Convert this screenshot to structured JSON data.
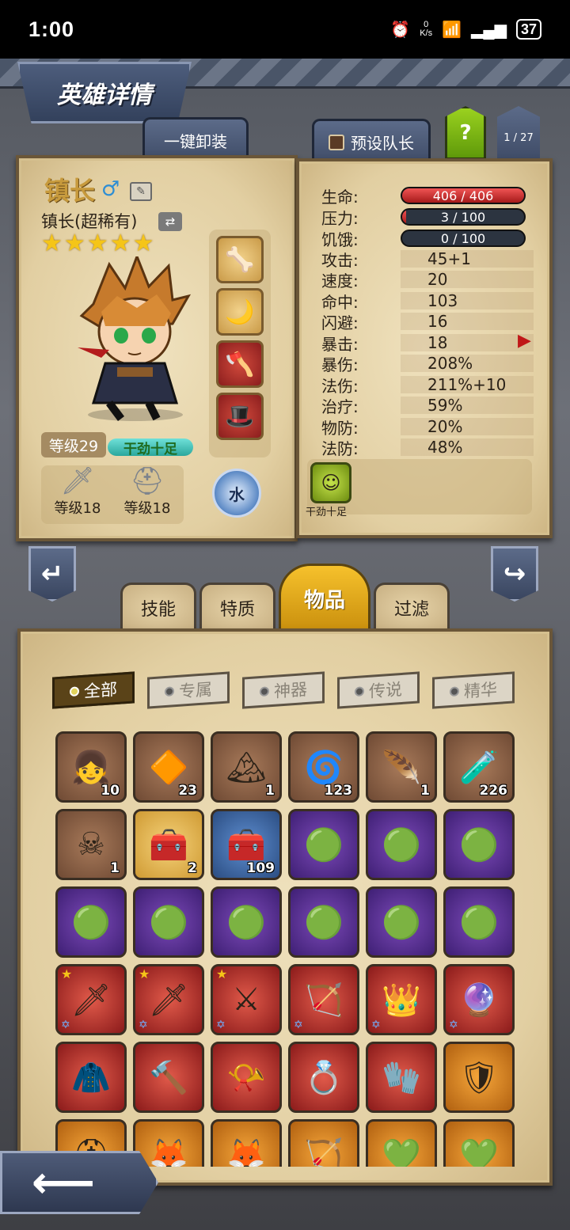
{
  "status_bar": {
    "time": "1:00",
    "net_speed_value": "0",
    "net_speed_unit": "K/s",
    "battery": "37"
  },
  "header": {
    "title": "英雄详情",
    "unequip_all": "一键卸装",
    "preset_leader": "预设队长",
    "help": "?",
    "page": "1 / 27"
  },
  "hero": {
    "name": "镇长",
    "subtitle": "镇长(超稀有)",
    "stars": 5,
    "level": "等级29",
    "status": "干劲十足",
    "weapon_level": "等级18",
    "armor_level": "等级18",
    "element": "水",
    "equipment_icons": [
      "bone-staff-icon",
      "moon-staff-icon",
      "double-axe-icon",
      "wizard-hat-icon"
    ]
  },
  "stats": {
    "hp": {
      "label": "生命:",
      "value": "406 / 406",
      "fraction": 1.0
    },
    "stress": {
      "label": "压力:",
      "value": "3 / 100",
      "fraction": 0.03
    },
    "hunger": {
      "label": "饥饿:",
      "value": "0 / 100",
      "fraction": 0.0
    },
    "rows": [
      {
        "label": "攻击:",
        "value": "45+1"
      },
      {
        "label": "速度:",
        "value": "20"
      },
      {
        "label": "命中:",
        "value": "103"
      },
      {
        "label": "闪避:",
        "value": "16"
      },
      {
        "label": "暴击:",
        "value": "18"
      },
      {
        "label": "暴伤:",
        "value": "208%"
      },
      {
        "label": "法伤:",
        "value": "211%+10"
      },
      {
        "label": "治疗:",
        "value": "59%"
      },
      {
        "label": "物防:",
        "value": "20%"
      },
      {
        "label": "法防:",
        "value": "48%"
      }
    ],
    "buff_label": "干劲十足"
  },
  "tabs": {
    "skills": "技能",
    "traits": "特质",
    "items": "物品",
    "filter": "过滤"
  },
  "filters": [
    "全部",
    "专属",
    "神器",
    "传说",
    "精华"
  ],
  "items": [
    {
      "icon": "girl-doll-icon",
      "glyph": "👧",
      "rarity": "brown",
      "count": "10"
    },
    {
      "icon": "fire-gem-icon",
      "glyph": "🔶",
      "rarity": "brown",
      "count": "23"
    },
    {
      "icon": "salt-pile-icon",
      "glyph": "🏔",
      "rarity": "brown",
      "count": "1"
    },
    {
      "icon": "dark-rune-icon",
      "glyph": "🌀",
      "rarity": "brown",
      "count": "123"
    },
    {
      "icon": "golden-feather-icon",
      "glyph": "🪶",
      "rarity": "brown",
      "count": "1"
    },
    {
      "icon": "potion-bottle-icon",
      "glyph": "🧪",
      "rarity": "brown",
      "count": "226"
    },
    {
      "icon": "pirate-doll-icon",
      "glyph": "☠",
      "rarity": "brown",
      "count": "1"
    },
    {
      "icon": "gold-chest-icon",
      "glyph": "🧰",
      "rarity": "gold",
      "count": "2"
    },
    {
      "icon": "blue-chest-icon",
      "glyph": "🧰",
      "rarity": "blue",
      "count": "109"
    },
    {
      "icon": "green-orb-icon",
      "glyph": "🟢",
      "rarity": "purple",
      "count": ""
    },
    {
      "icon": "green-orb-icon",
      "glyph": "🟢",
      "rarity": "purple",
      "count": ""
    },
    {
      "icon": "green-orb-icon",
      "glyph": "🟢",
      "rarity": "purple",
      "count": ""
    },
    {
      "icon": "green-orb-icon",
      "glyph": "🟢",
      "rarity": "purple",
      "count": ""
    },
    {
      "icon": "green-orb-icon",
      "glyph": "🟢",
      "rarity": "purple",
      "count": ""
    },
    {
      "icon": "green-orb-icon",
      "glyph": "🟢",
      "rarity": "purple",
      "count": ""
    },
    {
      "icon": "green-orb-icon",
      "glyph": "🟢",
      "rarity": "purple",
      "count": ""
    },
    {
      "icon": "green-orb-icon",
      "glyph": "🟢",
      "rarity": "purple",
      "count": ""
    },
    {
      "icon": "green-orb-icon",
      "glyph": "🟢",
      "rarity": "purple",
      "count": ""
    },
    {
      "icon": "sword-icon",
      "glyph": "🗡",
      "rarity": "red",
      "count": ""
    },
    {
      "icon": "water-sword-icon",
      "glyph": "🗡",
      "rarity": "red",
      "count": ""
    },
    {
      "icon": "gold-sword-icon",
      "glyph": "⚔",
      "rarity": "red",
      "count": ""
    },
    {
      "icon": "crossbow-icon",
      "glyph": "🏹",
      "rarity": "red",
      "count": ""
    },
    {
      "icon": "crown-icon",
      "glyph": "👑",
      "rarity": "red",
      "count": ""
    },
    {
      "icon": "magic-orb-icon",
      "glyph": "🔮",
      "rarity": "red",
      "count": ""
    },
    {
      "icon": "robe-icon",
      "glyph": "🧥",
      "rarity": "red",
      "count": ""
    },
    {
      "icon": "hammer-icon",
      "glyph": "🔨",
      "rarity": "red",
      "count": ""
    },
    {
      "icon": "horn-icon",
      "glyph": "📯",
      "rarity": "red",
      "count": ""
    },
    {
      "icon": "gem-ring-icon",
      "glyph": "💍",
      "rarity": "red",
      "count": ""
    },
    {
      "icon": "gauntlet-icon",
      "glyph": "🧤",
      "rarity": "red",
      "count": ""
    },
    {
      "icon": "dark-shield-icon",
      "glyph": "🛡",
      "rarity": "orange",
      "count": ""
    },
    {
      "icon": "horned-helm-icon",
      "glyph": "⛑",
      "rarity": "orange",
      "count": ""
    },
    {
      "icon": "fox-mask-icon",
      "glyph": "🦊",
      "rarity": "orange",
      "count": ""
    },
    {
      "icon": "fox-mask-icon",
      "glyph": "🦊",
      "rarity": "orange",
      "count": ""
    },
    {
      "icon": "bow-icon",
      "glyph": "🏹",
      "rarity": "orange",
      "count": ""
    },
    {
      "icon": "green-ring-icon",
      "glyph": "💚",
      "rarity": "orange",
      "count": ""
    },
    {
      "icon": "green-ring-icon",
      "glyph": "💚",
      "rarity": "orange",
      "count": ""
    }
  ],
  "colors": {
    "accent_gold": "#f6c12c",
    "hp_red": "#e13c3c",
    "parchment": "#e9d8b0",
    "help_green": "#8cc418"
  }
}
